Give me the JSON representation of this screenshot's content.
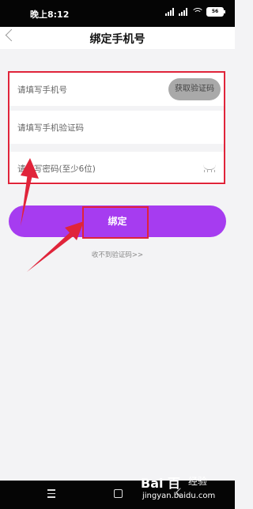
{
  "status_bar": {
    "time": "晚上8:12",
    "battery": "56"
  },
  "nav": {
    "title": "绑定手机号"
  },
  "form": {
    "phone_placeholder": "请填写手机号",
    "get_code_label": "获取验证码",
    "code_placeholder": "请填写手机验证码",
    "password_placeholder": "请填写密码(至少6位)"
  },
  "bind_button": {
    "label": "绑定"
  },
  "no_code_link": "收不到验证码>>",
  "watermark": {
    "logo": "Bai 百",
    "jingyan": "经验",
    "url": "jingyan.baidu.com"
  },
  "colors": {
    "accent": "#a63cf0",
    "annotation": "#e0243a"
  }
}
